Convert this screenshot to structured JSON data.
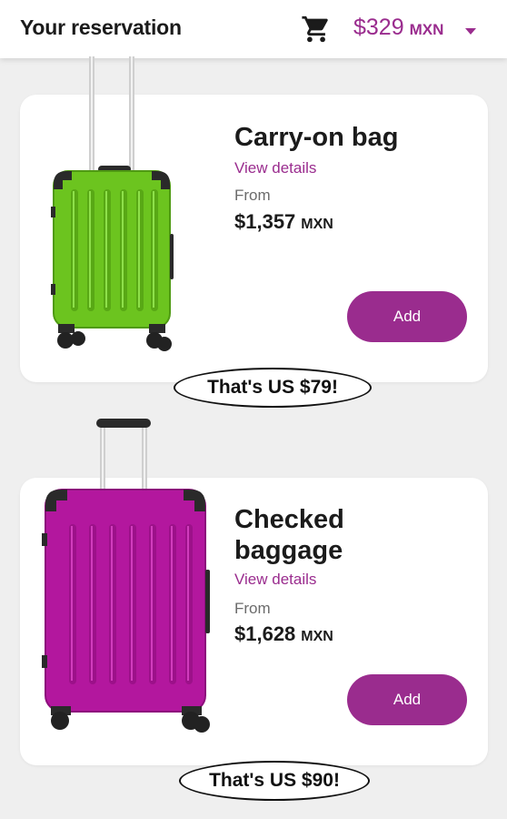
{
  "header": {
    "title": "Your reservation",
    "cart_icon": "shopping-cart-icon",
    "total_amount": "$329",
    "total_currency": "MXN",
    "dropdown_icon": "chevron-down-icon"
  },
  "colors": {
    "accent": "#9a2c8e",
    "carry_on_bag": "#6cc41f",
    "checked_bag": "#b3179e"
  },
  "items": [
    {
      "title": "Carry-on bag",
      "details_link": "View details",
      "from_label": "From",
      "price_amount": "$1,357",
      "price_currency": "MXN",
      "add_label": "Add",
      "note": "That's US $79!"
    },
    {
      "title": "Checked baggage",
      "details_link": "View details",
      "from_label": "From",
      "price_amount": "$1,628",
      "price_currency": "MXN",
      "add_label": "Add",
      "note": "That's US $90!"
    }
  ]
}
